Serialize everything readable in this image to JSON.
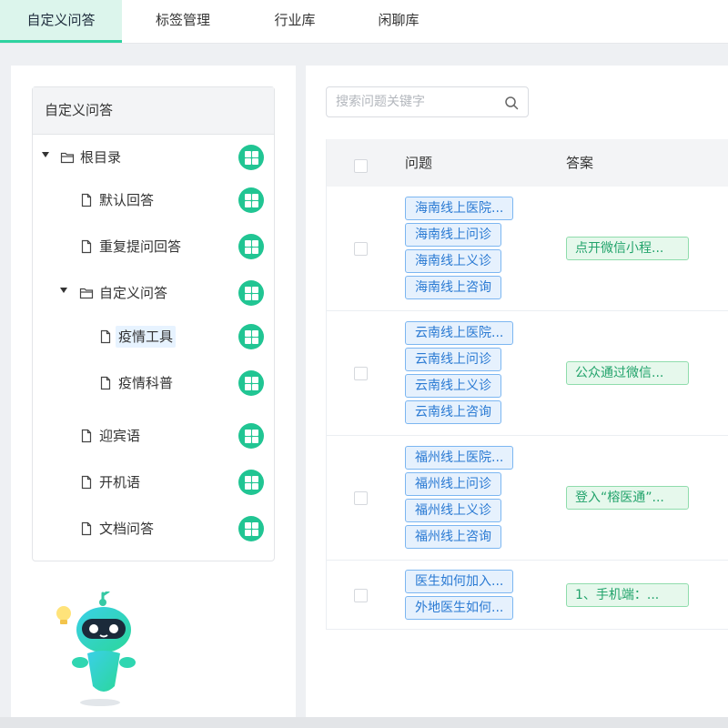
{
  "tabs": [
    {
      "label": "自定义问答",
      "active": true
    },
    {
      "label": "标签管理",
      "active": false
    },
    {
      "label": "行业库",
      "active": false
    },
    {
      "label": "闲聊库",
      "active": false
    }
  ],
  "tree": {
    "header": "自定义问答",
    "nodes": [
      {
        "label": "根目录",
        "type": "folder",
        "expanded": true,
        "level": 0,
        "selected": false
      },
      {
        "label": "默认回答",
        "type": "file",
        "level": 1,
        "selected": false
      },
      {
        "label": "重复提问回答",
        "type": "file",
        "level": 1,
        "selected": false
      },
      {
        "label": "自定义问答",
        "type": "folder",
        "expanded": true,
        "level": 1,
        "selected": false
      },
      {
        "label": "疫情工具",
        "type": "file",
        "level": 2,
        "selected": true
      },
      {
        "label": "疫情科普",
        "type": "file",
        "level": 2,
        "selected": false
      },
      {
        "label": "迎宾语",
        "type": "file",
        "level": 1,
        "selected": false
      },
      {
        "label": "开机语",
        "type": "file",
        "level": 1,
        "selected": false
      },
      {
        "label": "文档问答",
        "type": "file",
        "level": 1,
        "selected": false
      }
    ],
    "action_icon": "grid-icon"
  },
  "search": {
    "placeholder": "搜索问题关键字",
    "icon": "search-icon"
  },
  "table": {
    "columns": [
      "问题",
      "答案"
    ],
    "rows": [
      {
        "questions": [
          "海南线上医院...",
          "海南线上问诊",
          "海南线上义诊",
          "海南线上咨询"
        ],
        "answer": "点开微信小程..."
      },
      {
        "questions": [
          "云南线上医院...",
          "云南线上问诊",
          "云南线上义诊",
          "云南线上咨询"
        ],
        "answer": "公众通过微信..."
      },
      {
        "questions": [
          "福州线上医院...",
          "福州线上问诊",
          "福州线上义诊",
          "福州线上咨询"
        ],
        "answer": "登入“榕医通”..."
      },
      {
        "questions": [
          "医生如何加入...",
          "外地医生如何..."
        ],
        "answer": "1、手机端：..."
      }
    ]
  },
  "colors": {
    "accent": "#21c593",
    "tab_active_bg": "#dcf5ec",
    "question_tag": "#2a7ad3",
    "answer_tag": "#22a36b"
  }
}
